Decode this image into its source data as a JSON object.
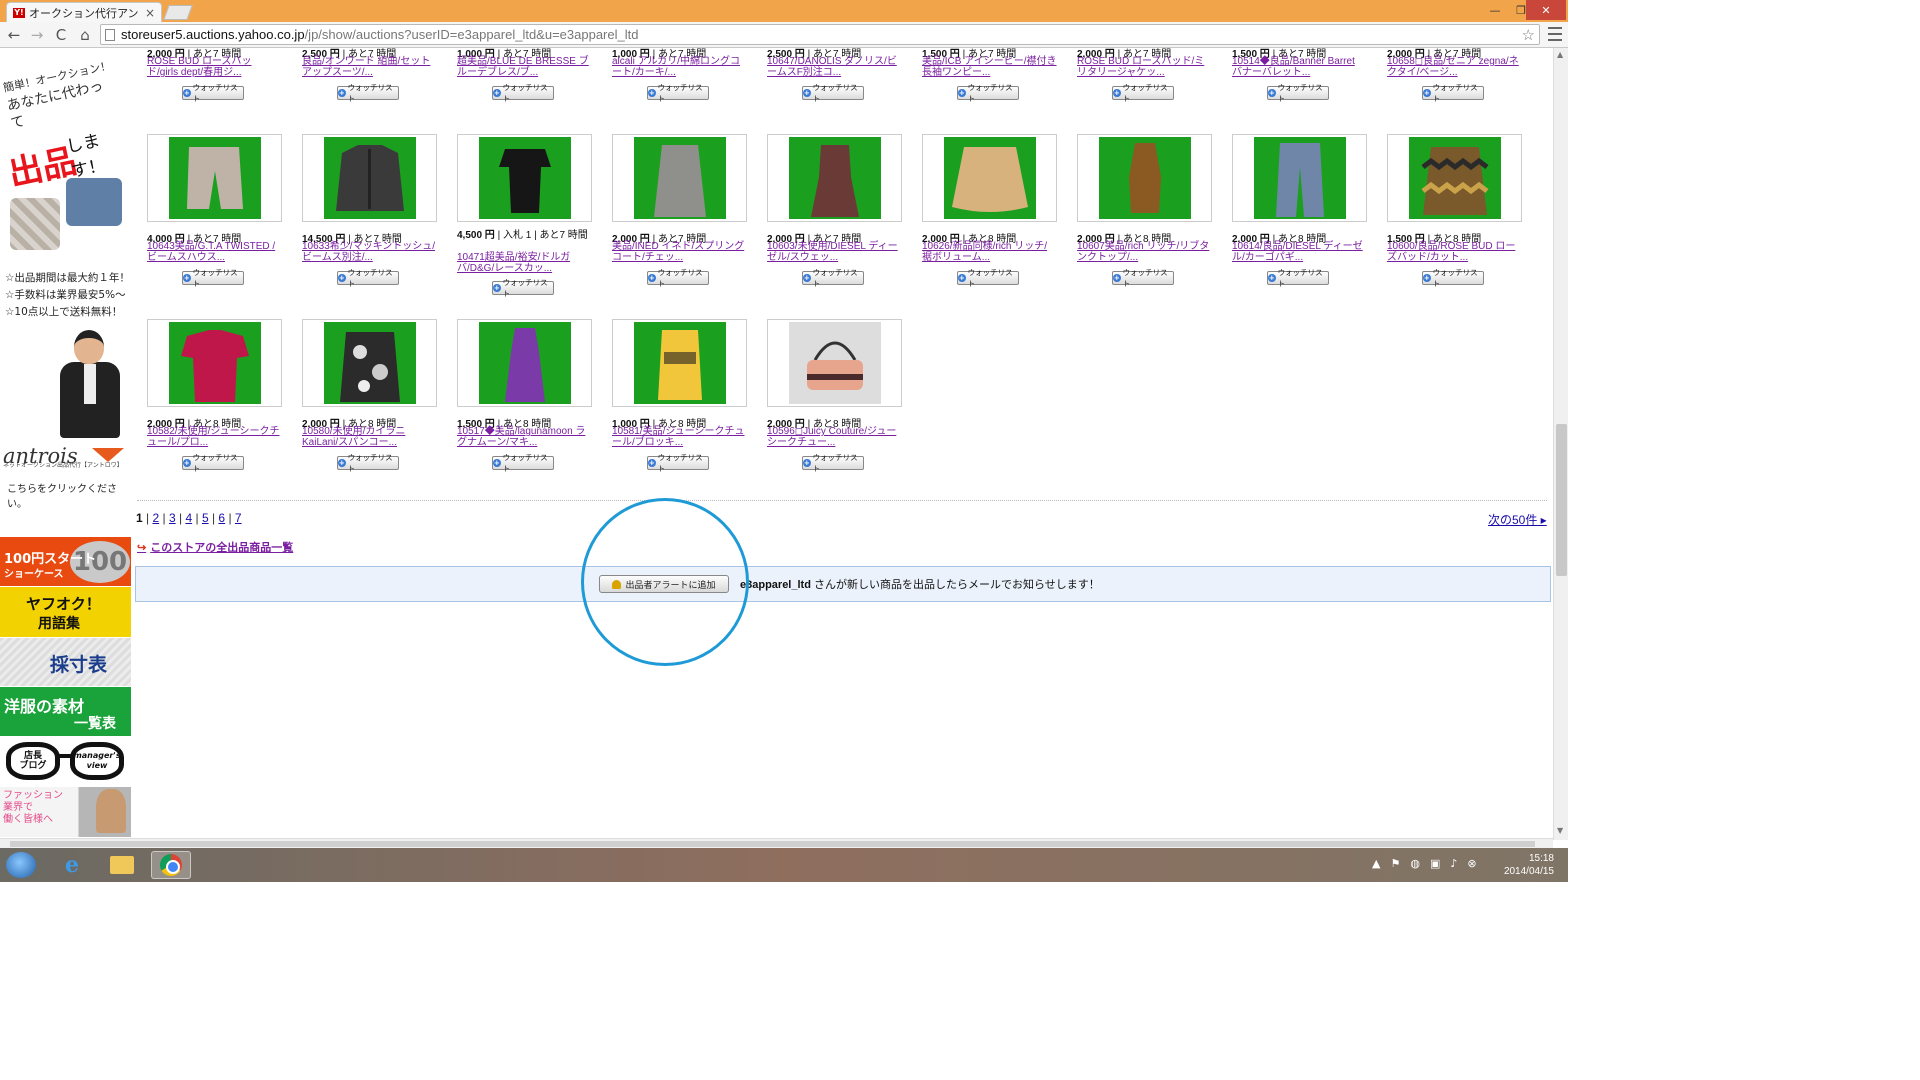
{
  "browser": {
    "tab_title": "オークション代行アントロワ（ま",
    "tab_close": "×",
    "url_host": "storeuser5.auctions.yahoo.co.jp",
    "url_path": "/jp/show/auctions?userID=e3apparel_ltd&u=e3apparel_ltd",
    "win_min": "—",
    "win_max": "❐",
    "win_close": "✕",
    "back": "←",
    "forward": "→",
    "reload": "C",
    "home": "⌂",
    "star": "☆",
    "favicon": "Y!"
  },
  "left_ad": {
    "line1": "簡単！オークション！",
    "line2": "あなたに代わって",
    "shuppin": "出品",
    "shimasu": "します！",
    "bullet1": "☆出品期間は最大約１年！",
    "bullet2": "☆手数料は業界最安5%～",
    "bullet3": "☆10点以上で送料無料！",
    "logo": "antrois",
    "logo_sub": "ネットオークション出品代行【アントロワ】",
    "click_text": "こちらをクリックください。"
  },
  "banners": {
    "b100_t1": "100円スタート",
    "b100_t2": "ショーケース",
    "b100_big": "100",
    "yafu_t1": "ヤフオク！",
    "yafu_t2": "用語集",
    "sai": "採寸表",
    "yofuku_t1": "洋服の素材",
    "yofuku_t2": "一覧表",
    "tencho_l": "店長\nブログ",
    "tencho_r": "manager's\nview",
    "fashion": "ファッション\n業界で\n働く皆様へ"
  },
  "watch_label": "ウォッチリスト",
  "top_row": [
    {
      "price": "2,000 円",
      "time": " | あと7 時間",
      "title": "ROSE BUD ローズバッド/girls dept/春用ジ..."
    },
    {
      "price": "2,500 円",
      "time": " | あと7 時間",
      "title": "良品/オンワード 組曲/セットアップスーツ/..."
    },
    {
      "price": "1,000 円",
      "time": " | あと7 時間",
      "title": "超美品/BLUE DE BRESSE ブルーデブレス/ブ..."
    },
    {
      "price": "1,000 円",
      "time": " | あと7 時間",
      "title": "alcali アルカリ/中綿ロングコート/カーキ/..."
    },
    {
      "price": "2,500 円",
      "time": " | あと7 時間",
      "title": "10647/DANOLIS ダノリス/ビームスF別注コ..."
    },
    {
      "price": "1,500 円",
      "time": " | あと7 時間",
      "title": "美品/ICB アイシービー/襟付き長袖ワンピー..."
    },
    {
      "price": "2,000 円",
      "time": " | あと7 時間",
      "title": "ROSE BUD ローズバッド/ミリタリージャケッ..."
    },
    {
      "price": "1,500 円",
      "time": " | あと7 時間",
      "title": "10514◆良品/Banner Barret バナーバレット..."
    },
    {
      "price": "2,000 円",
      "time": " | あと7 時間",
      "title": "10658◻良品/ゼニア zegna/ネクタイ/ベージ..."
    }
  ],
  "row2": [
    {
      "price": "4,000 円",
      "time": " | あと7 時間",
      "title": "10643美品/G.T.A TWISTED /ビームスハウス..."
    },
    {
      "price": "14,500 円",
      "time": " | あと7 時間",
      "title": "10633希少/マッキントッシュ/ビームス別注/..."
    },
    {
      "price": "4,500 円",
      "time": " | 入札 1 | あと7 時間",
      "title": "10471超美品/裕安/ドルガバ/D&G/レースカッ..."
    },
    {
      "price": "2,000 円",
      "time": " | あと7 時間",
      "title": "美品/INED イネド/スプリングコート/チェッ..."
    },
    {
      "price": "2,000 円",
      "time": " | あと7 時間",
      "title": "10603/未使用/DIESEL ディーゼル/スウェッ..."
    },
    {
      "price": "2,000 円",
      "time": " | あと8 時間",
      "title": "10626/新品同様/rich リッチ/裾ボリューム..."
    },
    {
      "price": "2,000 円",
      "time": " | あと8 時間",
      "title": "10607美品/rich リッチ/リブタンクトップ/..."
    },
    {
      "price": "2,000 円",
      "time": " | あと8 時間",
      "title": "10614/良品/DIESEL ディーゼル/カーゴパギ..."
    },
    {
      "price": "1,500 円",
      "time": " | あと8 時間",
      "title": "10600/良品/ROSE BUD ローズバッド/カット..."
    }
  ],
  "row3": [
    {
      "price": "2,000 円",
      "time": " | あと8 時間",
      "title": "10582/未使用/ジューシークチュール/プロ..."
    },
    {
      "price": "2,000 円",
      "time": " | あと8 時間",
      "title": "10580/未使用/カイラニ KaiLani/スパンコー..."
    },
    {
      "price": "1,500 円",
      "time": " | あと8 時間",
      "title": "10517◆美品/lagunamoon ラグナムーン/マキ..."
    },
    {
      "price": "1,000 円",
      "time": " | あと8 時間",
      "title": "10581/美品/ジューシークチュール/ブロッキ..."
    },
    {
      "price": "2,000 円",
      "time": " | あと8 時間",
      "title": "10596◻Juicy Couture/ジューシークチュー..."
    }
  ],
  "pager": {
    "current": "1",
    "pages": [
      "2",
      "3",
      "4",
      "5",
      "6",
      "7"
    ],
    "next": "次の50件 ▸"
  },
  "all_items_link": "このストアの全出品商品一覧",
  "all_items_arrow": "↪",
  "alert": {
    "button": "出品者アラートに追加",
    "seller": "e3apparel_ltd",
    "message": " さんが新しい商品を出品したらメールでお知らせします！"
  },
  "taskbar": {
    "time": "15:18",
    "date": "2014/04/15",
    "ie_glyph": "e",
    "tray_up": "▲",
    "tray_flag": "⚑",
    "tray_net": "◍",
    "tray_monitor": "▣",
    "tray_volume": "♪",
    "tray_close": "⊗"
  },
  "colors": {
    "link": "#7a1fa0",
    "accent_orange": "#f1a44a",
    "photo_bg": "#1b9f1f",
    "highlight_circle": "#1e9ad6"
  }
}
